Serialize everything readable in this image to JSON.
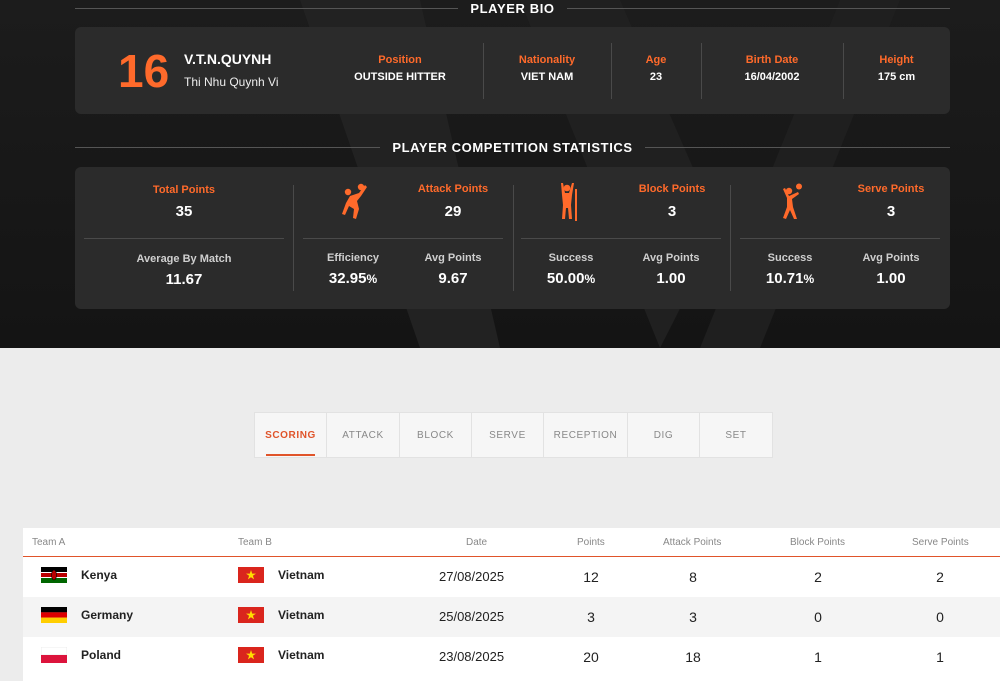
{
  "bio": {
    "section_title": "PLAYER BIO",
    "number": "16",
    "short_name": "V.T.N.QUYNH",
    "full_name": "Thi Nhu Quynh Vi",
    "fields": [
      {
        "label": "Position",
        "value": "OUTSIDE HITTER"
      },
      {
        "label": "Nationality",
        "value": "VIET NAM"
      },
      {
        "label": "Age",
        "value": "23"
      },
      {
        "label": "Birth Date",
        "value": "16/04/2002"
      },
      {
        "label": "Height",
        "value": "175 cm"
      }
    ]
  },
  "stats": {
    "section_title": "PLAYER COMPETITION STATISTICS",
    "total": {
      "label": "Total Points",
      "value": "35",
      "sub_label": "Average By Match",
      "sub_value": "11.67"
    },
    "attack": {
      "label": "Attack Points",
      "value": "29",
      "icon": "attack-icon",
      "left_label": "Efficiency",
      "left_value": "32.95",
      "left_unit": "%",
      "right_label": "Avg Points",
      "right_value": "9.67"
    },
    "block": {
      "label": "Block Points",
      "value": "3",
      "icon": "block-icon",
      "left_label": "Success",
      "left_value": "50.00",
      "left_unit": "%",
      "right_label": "Avg Points",
      "right_value": "1.00"
    },
    "serve": {
      "label": "Serve Points",
      "value": "3",
      "icon": "serve-icon",
      "left_label": "Success",
      "left_value": "10.71",
      "left_unit": "%",
      "right_label": "Avg Points",
      "right_value": "1.00"
    }
  },
  "tabs": [
    "SCORING",
    "ATTACK",
    "BLOCK",
    "SERVE",
    "RECEPTION",
    "DIG",
    "SET"
  ],
  "active_tab": "SCORING",
  "table": {
    "headers": [
      "Team A",
      "Team B",
      "Date",
      "Points",
      "Attack Points",
      "Block Points",
      "Serve Points"
    ],
    "rows": [
      {
        "team_a": "Kenya",
        "team_a_flag": "kenya-flag-icon",
        "team_b": "Vietnam",
        "team_b_flag": "vietnam-flag-icon",
        "date": "27/08/2025",
        "points": "12",
        "attack": "8",
        "block": "2",
        "serve": "2"
      },
      {
        "team_a": "Germany",
        "team_a_flag": "germany-flag-icon",
        "team_b": "Vietnam",
        "team_b_flag": "vietnam-flag-icon",
        "date": "25/08/2025",
        "points": "3",
        "attack": "3",
        "block": "0",
        "serve": "0"
      },
      {
        "team_a": "Poland",
        "team_a_flag": "poland-flag-icon",
        "team_b": "Vietnam",
        "team_b_flag": "vietnam-flag-icon",
        "date": "23/08/2025",
        "points": "20",
        "attack": "18",
        "block": "1",
        "serve": "1"
      }
    ]
  },
  "colors": {
    "accent": "#ff6a2b",
    "tab_accent": "#e0542a",
    "dark_bg": "#181818",
    "card_bg": "#2b2b2b"
  }
}
